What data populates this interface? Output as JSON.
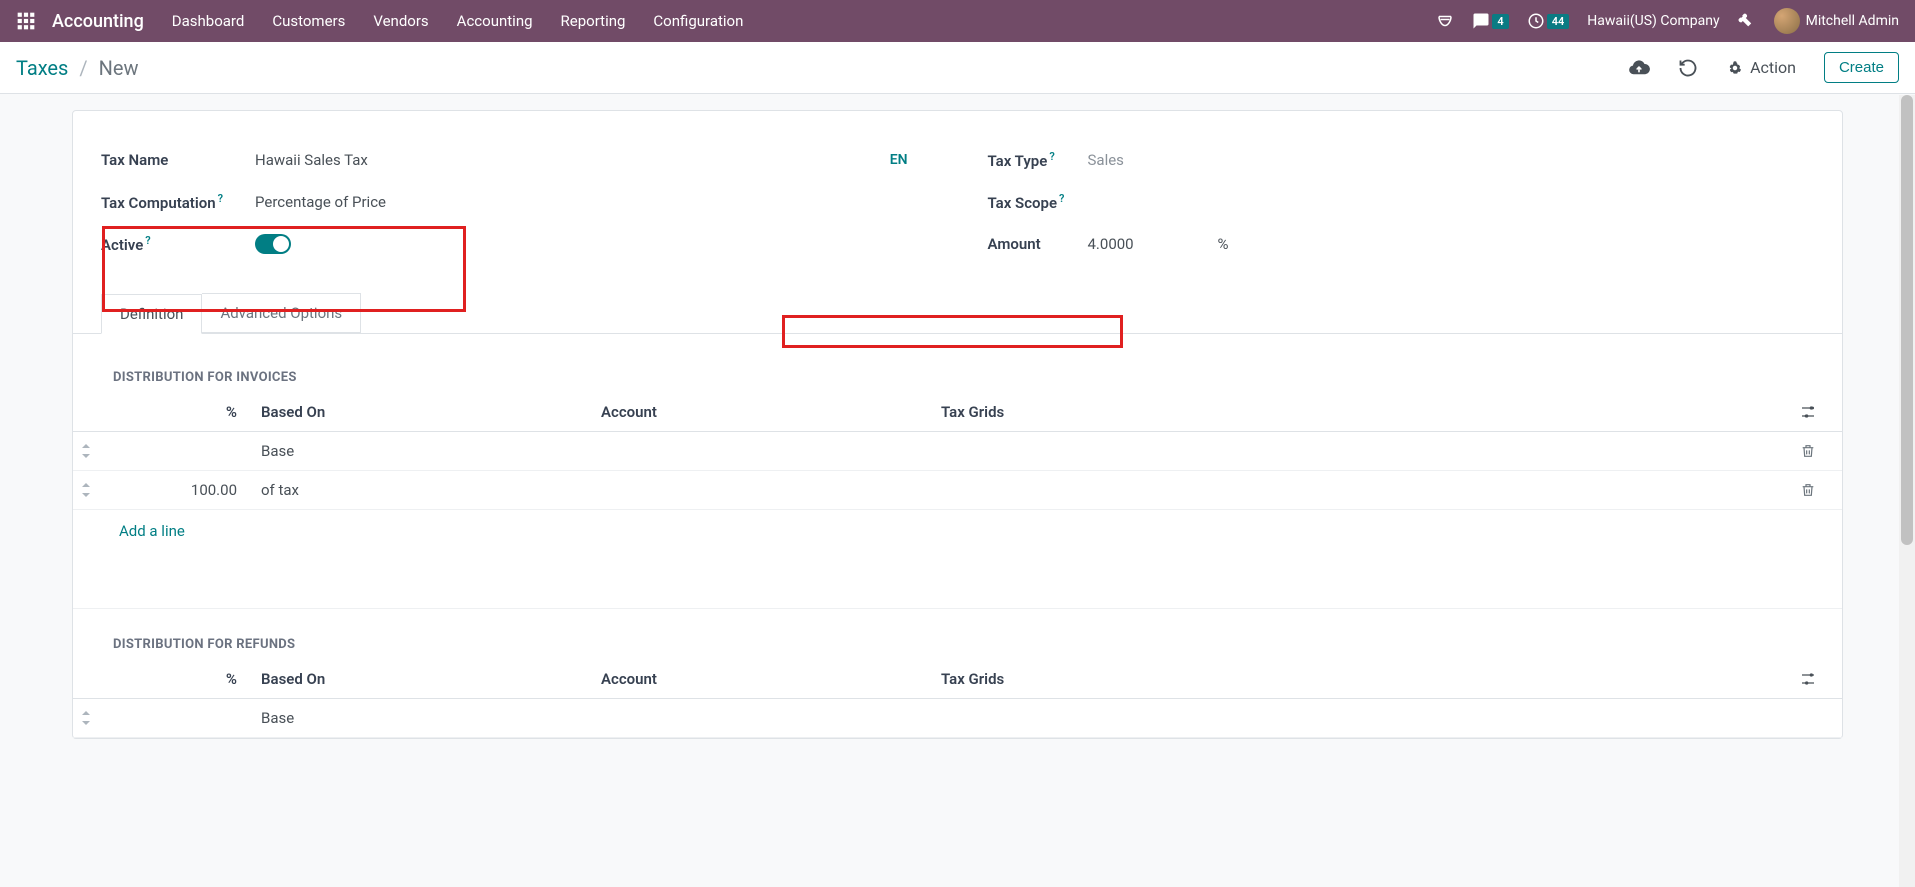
{
  "navbar": {
    "app_name": "Accounting",
    "items": [
      "Dashboard",
      "Customers",
      "Vendors",
      "Accounting",
      "Reporting",
      "Configuration"
    ],
    "chat_badge": "4",
    "activity_badge": "44",
    "company": "Hawaii(US) Company",
    "user": "Mitchell Admin"
  },
  "toolbar": {
    "breadcrumb_root": "Taxes",
    "breadcrumb_current": "New",
    "action_label": "Action",
    "create_label": "Create"
  },
  "form": {
    "tax_name_label": "Tax Name",
    "tax_name_value": "Hawaii Sales Tax",
    "tax_computation_label": "Tax Computation",
    "tax_computation_value": "Percentage of Price",
    "active_label": "Active",
    "lang_badge": "EN",
    "tax_type_label": "Tax Type",
    "tax_type_value": "Sales",
    "tax_scope_label": "Tax Scope",
    "amount_label": "Amount",
    "amount_value": "4.0000",
    "amount_unit": "%"
  },
  "tabs": {
    "definition": "Definition",
    "advanced": "Advanced Options"
  },
  "distribution": {
    "invoices_title": "DISTRIBUTION FOR INVOICES",
    "refunds_title": "DISTRIBUTION FOR REFUNDS",
    "col_pct": "%",
    "col_based": "Based On",
    "col_account": "Account",
    "col_grids": "Tax Grids",
    "add_line": "Add a line",
    "inv_rows": [
      {
        "pct": "",
        "based": "Base"
      },
      {
        "pct": "100.00",
        "based": "of tax"
      }
    ],
    "ref_rows": [
      {
        "pct": "",
        "based": "Base"
      }
    ]
  }
}
